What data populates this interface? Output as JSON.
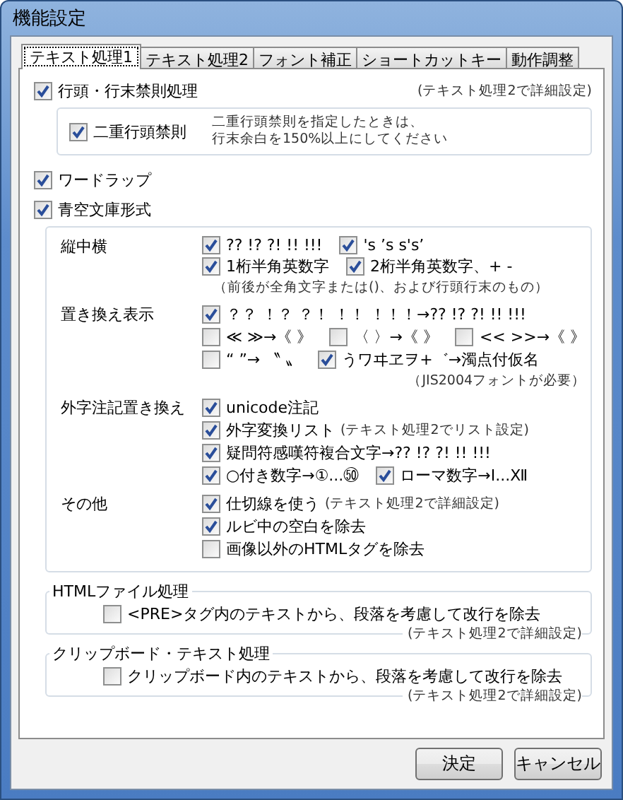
{
  "window": {
    "title": "機能設定"
  },
  "tabs": [
    {
      "label": "テキスト処理1",
      "selected": true
    },
    {
      "label": "テキスト処理2",
      "selected": false
    },
    {
      "label": "フォント補正",
      "selected": false
    },
    {
      "label": "ショートカットキー",
      "selected": false
    },
    {
      "label": "動作調整",
      "selected": false
    }
  ],
  "kinsoku": {
    "label": "行頭・行末禁則処理",
    "checked": true,
    "note": "(テキスト処理2で詳細設定)",
    "double": {
      "label": "二重行頭禁則",
      "checked": true,
      "note_lines": [
        "二重行頭禁則を指定したときは、",
        "行末余白を150%以上にしてください"
      ]
    }
  },
  "word_wrap": {
    "label": "ワードラップ",
    "checked": true
  },
  "aozora": {
    "label": "青空文庫形式",
    "checked": true,
    "groups": [
      {
        "label": "縦中横",
        "lines": [
          {
            "kind": "checks",
            "items": [
              {
                "label": "?? !? ?! !! !!!",
                "checked": true
              },
              {
                "label": "'s ’s s's’",
                "checked": true
              }
            ]
          },
          {
            "kind": "checks",
            "items": [
              {
                "label": "1桁半角英数字",
                "checked": true
              },
              {
                "label": "2桁半角英数字、+ -",
                "checked": true
              }
            ]
          },
          {
            "kind": "note",
            "text": "（前後が全角文字または()、および行頭行末のもの）"
          }
        ]
      },
      {
        "label": "置き換え表示",
        "lines": [
          {
            "kind": "checks",
            "items": [
              {
                "label": "？？ ！？ ？！ ！！ ！！！→?? !? ?! !! !!!",
                "checked": true
              }
            ]
          },
          {
            "kind": "checks",
            "items": [
              {
                "label": "≪ ≫→《 》",
                "checked": false
              },
              {
                "label": "〈 〉→《 》",
                "checked": false
              },
              {
                "label": "<< >>→《 》",
                "checked": false
              }
            ]
          },
          {
            "kind": "checks",
            "items": [
              {
                "label": "“ ”→ 〝 〟",
                "checked": false
              },
              {
                "label": "うワヰヱヲ+゛→濁点付仮名",
                "checked": true
              }
            ]
          },
          {
            "kind": "note",
            "text": "（JIS2004フォントが必要）"
          }
        ]
      },
      {
        "label": "外字注記置き換え",
        "lines": [
          {
            "kind": "checks",
            "items": [
              {
                "label": "unicode注記",
                "checked": true
              }
            ]
          },
          {
            "kind": "checks",
            "items": [
              {
                "label": "外字変換リスト",
                "checked": true,
                "note": "(テキスト処理2でリスト設定)"
              }
            ]
          },
          {
            "kind": "checks",
            "items": [
              {
                "label": "疑問符感嘆符複合文字→?? !? ?! !! !!!",
                "checked": true
              }
            ]
          },
          {
            "kind": "checks",
            "items": [
              {
                "label": "○付き数字→①...㊿",
                "checked": true
              },
              {
                "label": "ローマ数字→Ⅰ...Ⅻ",
                "checked": true
              }
            ]
          }
        ]
      },
      {
        "label": "その他",
        "lines": [
          {
            "kind": "checks",
            "items": [
              {
                "label": "仕切線を使う",
                "checked": true,
                "note": "(テキスト処理2で詳細設定)"
              }
            ]
          },
          {
            "kind": "checks",
            "items": [
              {
                "label": "ルビ中の空白を除去",
                "checked": true
              }
            ]
          },
          {
            "kind": "checks",
            "items": [
              {
                "label": "画像以外のHTMLタグを除去",
                "checked": false
              }
            ]
          }
        ]
      }
    ]
  },
  "sections": [
    {
      "legend": "HTMLファイル処理",
      "option": {
        "label": "<PRE>タグ内のテキストから、段落を考慮して改行を除去",
        "checked": false
      },
      "note": "(テキスト処理2で詳細設定)"
    },
    {
      "legend": "クリップボード・テキスト処理",
      "option": {
        "label": "クリップボード内のテキストから、段落を考慮して改行を除去",
        "checked": false
      },
      "note": "(テキスト処理2で詳細設定)"
    }
  ],
  "buttons": [
    "決定",
    "キャンセル"
  ]
}
